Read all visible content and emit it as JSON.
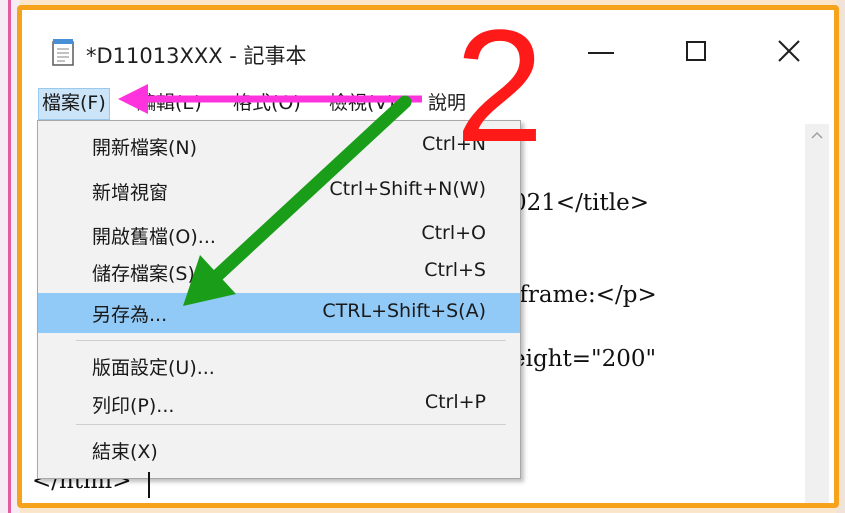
{
  "window": {
    "title": "*D11013XXX - 記事本"
  },
  "menubar": {
    "items": [
      {
        "label": "檔案(F)",
        "active": true
      },
      {
        "label": "編輯(E)",
        "active": false
      },
      {
        "label": "格式(O)",
        "active": false
      },
      {
        "label": "檢視(V)",
        "active": false
      },
      {
        "label": "說明",
        "active": false
      }
    ]
  },
  "file_menu": {
    "items": [
      {
        "label": "開新檔案(N)",
        "shortcut": "Ctrl+N"
      },
      {
        "label": "新增視窗",
        "shortcut": "Ctrl+Shift+N(W)"
      },
      {
        "label": "開啟舊檔(O)...",
        "shortcut": "Ctrl+O"
      },
      {
        "label": "儲存檔案(S)",
        "shortcut": "Ctrl+S"
      },
      {
        "label": "另存為...",
        "shortcut": "CTRL+Shift+S(A)",
        "highlighted": true
      },
      {
        "label": "版面設定(U)...",
        "shortcut": ""
      },
      {
        "label": "列印(P)...",
        "shortcut": "Ctrl+P"
      },
      {
        "label": "結束(X)",
        "shortcut": ""
      }
    ]
  },
  "editor": {
    "lines": [
      "021</title>",
      "iframe:</p>",
      "eight=\"200\"",
      "</html>"
    ]
  },
  "annotations": {
    "step_number": "2",
    "arrow_colors": {
      "magenta": "#ff33dd",
      "green": "#1a9e1a"
    },
    "step_color": "#ff1a1a",
    "frame_color": "#f7a21b",
    "highlight_color": "#91c9f7"
  }
}
